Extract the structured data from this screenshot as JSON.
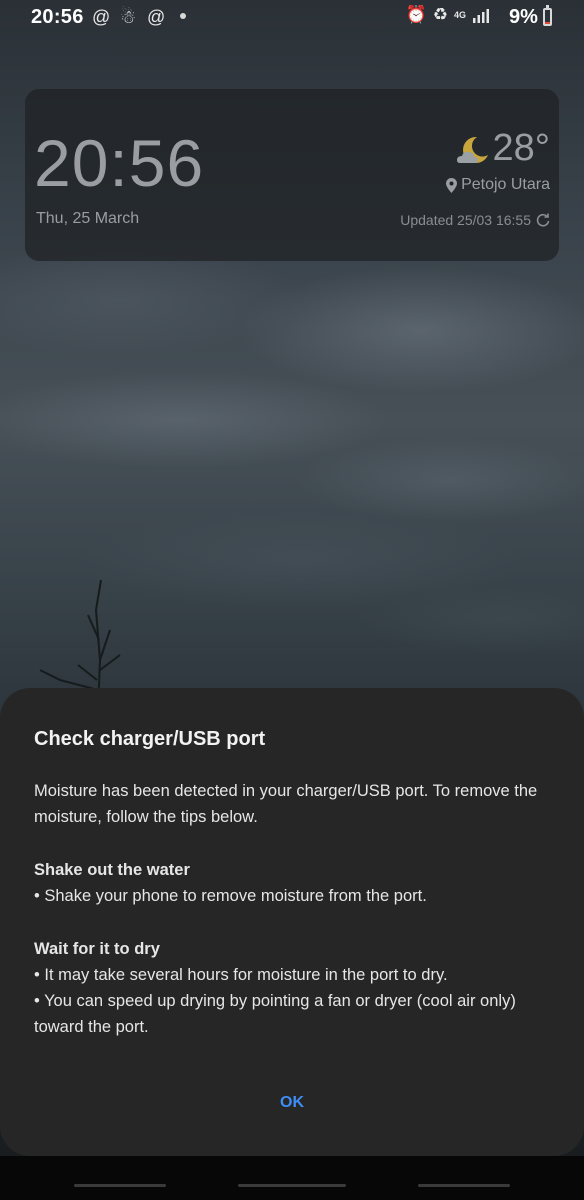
{
  "status_bar": {
    "time": "20:56",
    "notification_icons": [
      "threads-icon",
      "app-icon",
      "threads-icon",
      "dot"
    ],
    "right_icons": [
      "alarm-icon",
      "battery-saver-icon",
      "wifi-4g-icon",
      "signal-icon"
    ],
    "network_label": "4G",
    "battery_percent": "9%",
    "battery_level": 0.09,
    "battery_color": "#e04a3a"
  },
  "widget": {
    "time": "20:56",
    "date": "Thu, 25 March",
    "temperature": "28°",
    "weather_icon": "partly-cloudy-night-icon",
    "location": "Petojo Utara",
    "updated": "Updated 25/03 16:55"
  },
  "dialog": {
    "title": "Check charger/USB port",
    "intro": "Moisture has been detected in your charger/USB port. To remove the moisture, follow the tips below.",
    "section1_heading": "Shake out the water",
    "section1_item1": "• Shake your phone to remove moisture from the port.",
    "section2_heading": "Wait for it to dry",
    "section2_item1": "• It may take several hours for moisture in the port to dry.",
    "section2_item2": "• You can speed up drying by pointing a fan or dryer (cool air only) toward the port.",
    "ok_label": "OK",
    "accent": "#3e8ef7"
  }
}
